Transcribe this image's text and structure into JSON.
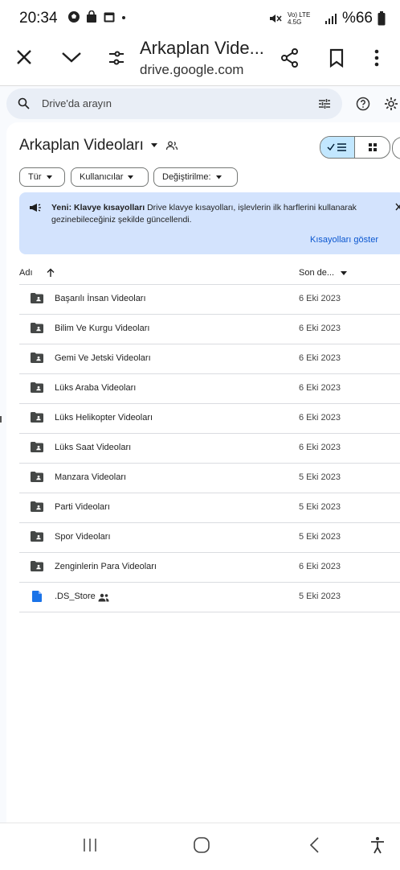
{
  "status_bar": {
    "time": "20:34",
    "battery": "%66",
    "network": "Vo) LTE 4.5G"
  },
  "toolbar": {
    "title": "Arkaplan Vide...",
    "url": "drive.google.com"
  },
  "search": {
    "placeholder": "Drive'da arayın"
  },
  "folder": {
    "title": "Arkaplan Videoları"
  },
  "filters": {
    "type": "Tür",
    "people": "Kullanıcılar",
    "modified": "Değiştirilme:"
  },
  "banner": {
    "bold": "Yeni: Klavye kısayolları",
    "text": " Drive klavye kısayolları, işlevlerin ilk harflerini kullanarak gezinebileceğiniz şekilde güncellendi.",
    "link": "Kısayolları göster"
  },
  "columns": {
    "name": "Adı",
    "date": "Son de..."
  },
  "files": [
    {
      "name": "Başarılı İnsan Videoları",
      "date": "6 Eki 2023",
      "kind": "folder"
    },
    {
      "name": "Bilim Ve Kurgu Videoları",
      "date": "6 Eki 2023",
      "kind": "folder"
    },
    {
      "name": "Gemi Ve Jetski Videoları",
      "date": "6 Eki 2023",
      "kind": "folder"
    },
    {
      "name": "Lüks Araba Videoları",
      "date": "6 Eki 2023",
      "kind": "folder"
    },
    {
      "name": "Lüks Helikopter Videoları",
      "date": "6 Eki 2023",
      "kind": "folder"
    },
    {
      "name": "Lüks Saat Videoları",
      "date": "6 Eki 2023",
      "kind": "folder"
    },
    {
      "name": "Manzara Videoları",
      "date": "5 Eki 2023",
      "kind": "folder"
    },
    {
      "name": "Parti Videoları",
      "date": "5 Eki 2023",
      "kind": "folder"
    },
    {
      "name": "Spor Videoları",
      "date": "5 Eki 2023",
      "kind": "folder"
    },
    {
      "name": "Zenginlerin Para Videoları",
      "date": "6 Eki 2023",
      "kind": "folder"
    },
    {
      "name": ".DS_Store",
      "date": "5 Eki 2023",
      "kind": "file"
    }
  ],
  "colors": {
    "accent": "#0b57d0",
    "banner_bg": "#d3e3fd",
    "search_bg": "#e9eef6",
    "file_blue": "#1a73e8"
  }
}
